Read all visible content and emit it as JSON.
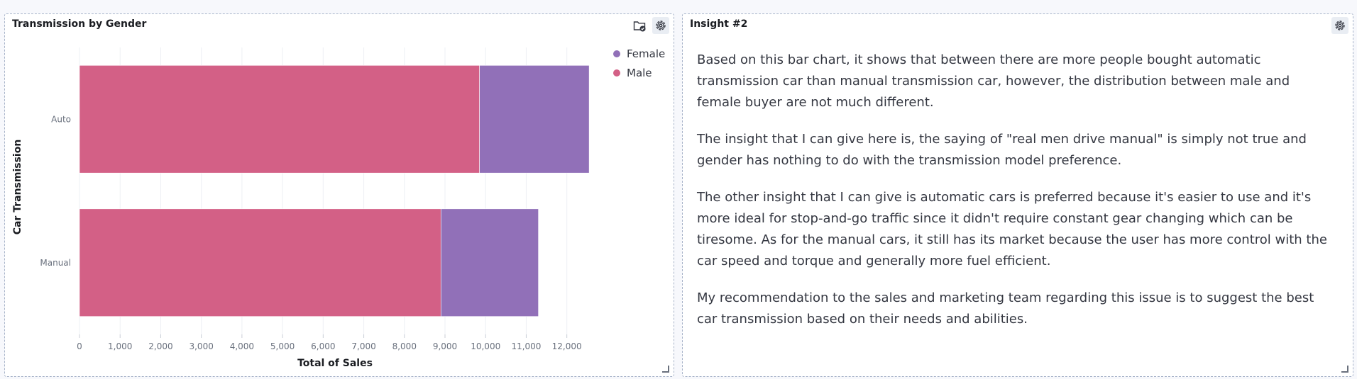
{
  "left_panel": {
    "title": "Transmission by Gender"
  },
  "right_panel": {
    "title": "Insight #2",
    "paragraphs": [
      "Based on this bar chart, it shows that between there are more people bought automatic transmission car than manual transmission car, however, the distribution between male and female buyer are not much different.",
      "The insight that I can give here is, the saying of \"real men drive manual\" is simply not true and gender has nothing to do with the transmission model preference.",
      "The other insight that I can give is automatic cars is preferred because it's easier to use and it's more ideal for stop-and-go traffic since it didn't require constant gear changing which can be tiresome. As for the manual cars, it still has its market because the user has more control with the car speed and torque and generally more fuel efficient.",
      "My recommendation to the sales and marketing team regarding this issue is to suggest the best car transmission based on their needs and abilities."
    ]
  },
  "icons": {
    "folder": "folder-check-icon",
    "settings": "gear-icon",
    "resize": "resize-corner-icon"
  },
  "chart_data": {
    "type": "bar",
    "orientation": "horizontal",
    "stacked": true,
    "title": "Transmission by Gender",
    "xlabel": "Total of Sales",
    "ylabel": "Car Transmission",
    "categories": [
      "Auto",
      "Manual"
    ],
    "series": [
      {
        "name": "Male",
        "values": [
          9850,
          8900
        ],
        "color": "#d36086"
      },
      {
        "name": "Female",
        "values": [
          2700,
          2400
        ],
        "color": "#9170b8"
      }
    ],
    "xlim": [
      0,
      12600
    ],
    "xticks": [
      0,
      1000,
      2000,
      3000,
      4000,
      5000,
      6000,
      7000,
      8000,
      9000,
      10000,
      11000,
      12000
    ],
    "xtick_labels": [
      "0",
      "1,000",
      "2,000",
      "3,000",
      "4,000",
      "5,000",
      "6,000",
      "7,000",
      "8,000",
      "9,000",
      "10,000",
      "11,000",
      "12,000"
    ],
    "grid": true,
    "legend": {
      "position": "top-right",
      "order": [
        "Female",
        "Male"
      ]
    }
  }
}
